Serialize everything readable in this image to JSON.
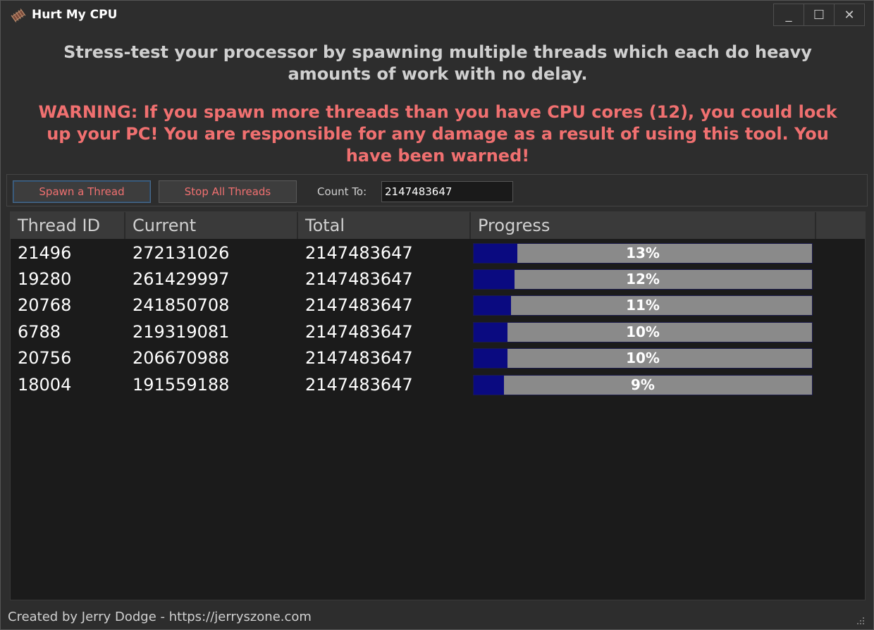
{
  "window": {
    "title": "Hurt My CPU",
    "controls": {
      "minimize": "_",
      "maximize": "☐",
      "close": "✕"
    }
  },
  "intro": "Stress-test your processor by spawning multiple threads which each do heavy amounts of work with no delay.",
  "warning": "WARNING: If you spawn more threads than you have CPU cores (12), you could lock up your PC! You are responsible for any damage as a result of using this tool. You have been warned!",
  "toolbar": {
    "spawn_label": "Spawn a Thread",
    "stop_label": "Stop All Threads",
    "count_label": "Count To:",
    "count_value": "2147483647"
  },
  "table": {
    "columns": [
      "Thread ID",
      "Current",
      "Total",
      "Progress"
    ],
    "rows": [
      {
        "id": "21496",
        "current": "272131026",
        "total": "2147483647",
        "progress": "13%",
        "fraction": 0.13
      },
      {
        "id": "19280",
        "current": "261429997",
        "total": "2147483647",
        "progress": "12%",
        "fraction": 0.12
      },
      {
        "id": "20768",
        "current": "241850708",
        "total": "2147483647",
        "progress": "11%",
        "fraction": 0.11
      },
      {
        "id": "6788",
        "current": "219319081",
        "total": "2147483647",
        "progress": "10%",
        "fraction": 0.1
      },
      {
        "id": "20756",
        "current": "206670988",
        "total": "2147483647",
        "progress": "10%",
        "fraction": 0.1
      },
      {
        "id": "18004",
        "current": "191559188",
        "total": "2147483647",
        "progress": "9%",
        "fraction": 0.09
      }
    ]
  },
  "status": "Created by Jerry Dodge - https://jerryszone.com",
  "colors": {
    "background": "#2d2d2d",
    "grid_background": "#1b1b1b",
    "warning_text": "#f07070",
    "progress_fill": "#0a0a80",
    "progress_track": "#8a8a8a"
  }
}
